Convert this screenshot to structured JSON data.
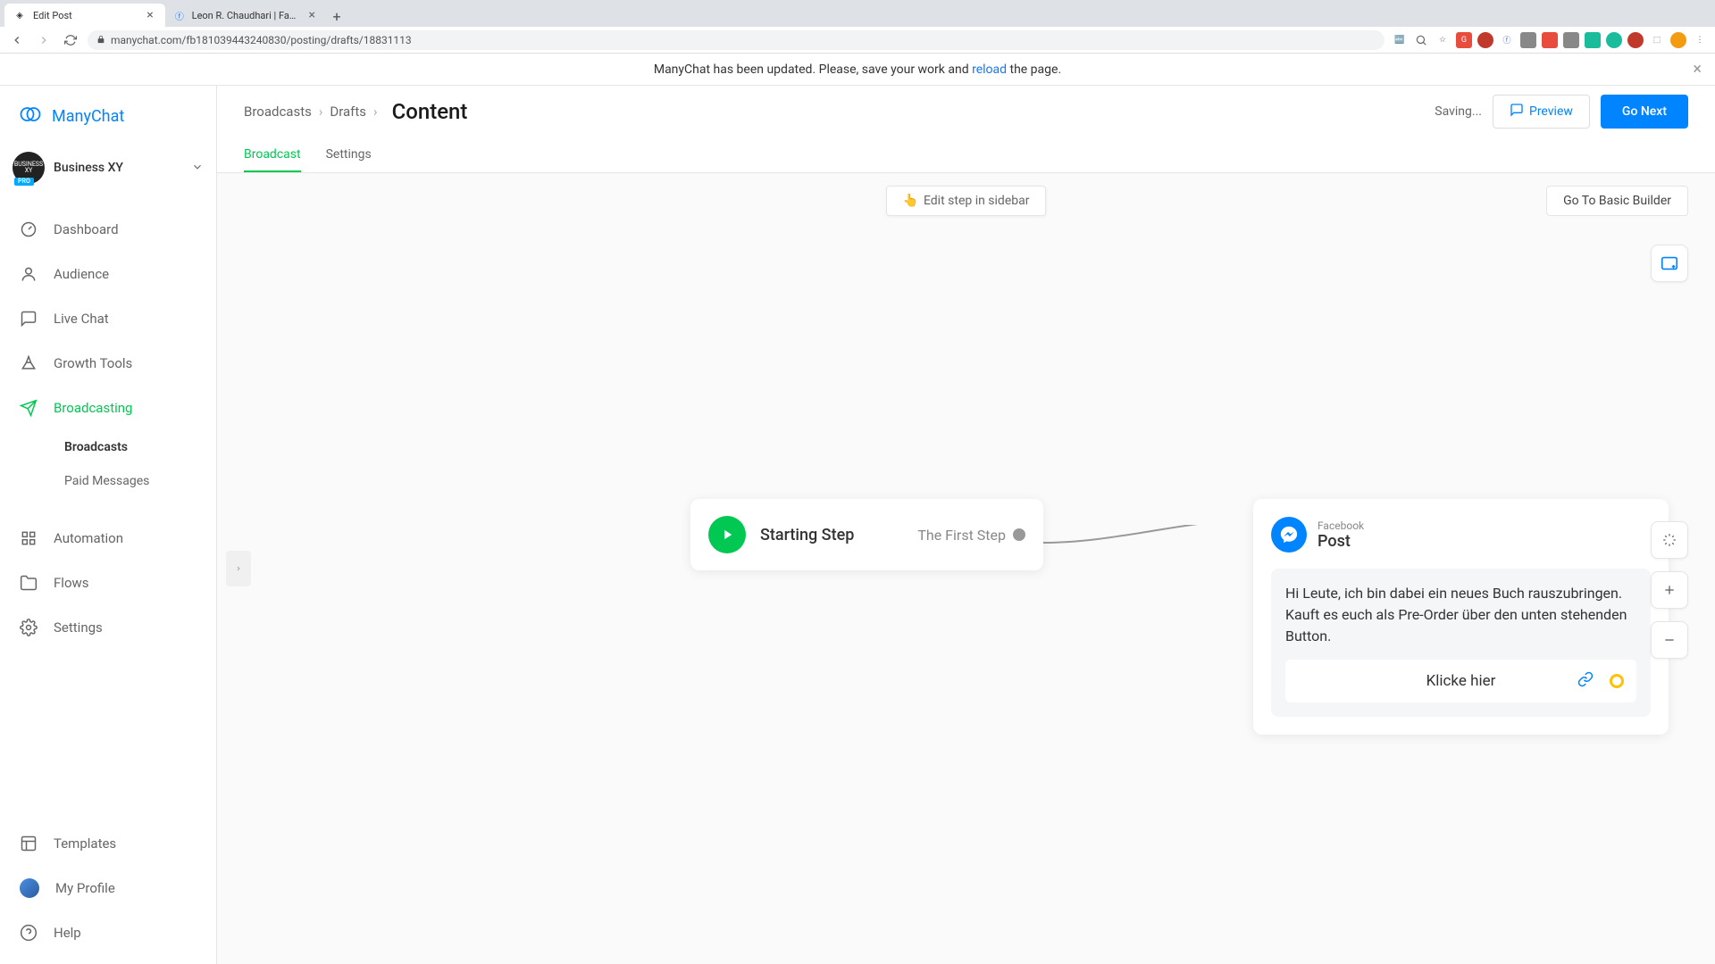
{
  "browser": {
    "tabs": [
      {
        "title": "Edit Post",
        "active": true
      },
      {
        "title": "Leon R. Chaudhari | Facebook",
        "active": false
      }
    ],
    "url": "manychat.com/fb181039443240830/posting/drafts/18831113"
  },
  "alert": {
    "text_pre": "ManyChat has been updated. Please, save your work and ",
    "link": "reload",
    "text_post": " the page."
  },
  "logo": "ManyChat",
  "account": {
    "name": "Business XY",
    "badge": "PRO"
  },
  "nav": {
    "dashboard": "Dashboard",
    "audience": "Audience",
    "livechat": "Live Chat",
    "growth": "Growth Tools",
    "broadcasting": "Broadcasting",
    "sub_broadcasts": "Broadcasts",
    "sub_paid": "Paid Messages",
    "automation": "Automation",
    "flows": "Flows",
    "settings": "Settings",
    "templates": "Templates",
    "profile": "My Profile",
    "help": "Help"
  },
  "header": {
    "bc1": "Broadcasts",
    "bc2": "Drafts",
    "title": "Content",
    "saving": "Saving...",
    "preview": "Preview",
    "next": "Go Next"
  },
  "tabs": {
    "broadcast": "Broadcast",
    "settings": "Settings"
  },
  "canvas": {
    "edit_sidebar": "Edit step in sidebar",
    "basic_builder": "Go To Basic Builder"
  },
  "start_node": {
    "title": "Starting Step",
    "first": "The First Step"
  },
  "post_node": {
    "channel": "Facebook",
    "type": "Post",
    "text": "Hi Leute, ich bin dabei ein neues Buch rauszubringen. Kauft es euch als Pre-Order über den unten stehenden Button.",
    "button": "Klicke hier"
  }
}
